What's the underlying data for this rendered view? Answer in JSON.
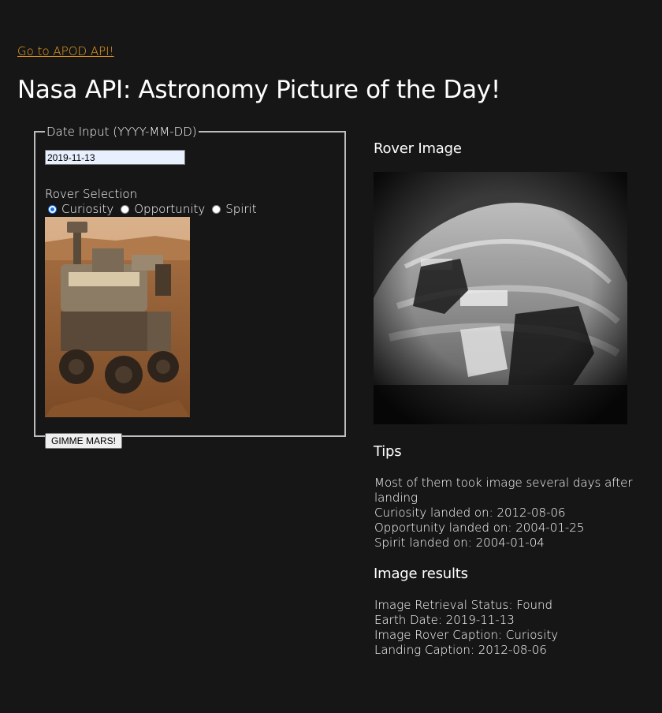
{
  "nav": {
    "apod_link": "Go to APOD API!"
  },
  "page_title": "Nasa API: Astronomy Picture of the Day!",
  "form": {
    "legend": "Date Input (YYYY-MM-DD)",
    "date_value": "2019-11-13",
    "rover_selection_label": "Rover Selection",
    "rovers": [
      {
        "label": "Curiosity",
        "checked": true
      },
      {
        "label": "Opportunity",
        "checked": false
      },
      {
        "label": "Spirit",
        "checked": false
      }
    ],
    "submit_label": "GIMME MARS!"
  },
  "rover_image": {
    "heading": "Rover Image"
  },
  "tips": {
    "heading": "Tips",
    "lines": [
      "Most of them took image several days after landing",
      "Curiosity landed on: 2012-08-06",
      "Opportunity landed on: 2004-01-25",
      "Spirit landed on: 2004-01-04"
    ]
  },
  "results": {
    "heading": "Image results",
    "lines": [
      "Image Retrieval Status: Found",
      "Earth Date: 2019-11-13",
      "Image Rover Caption: Curiosity",
      "Landing Caption: 2012-08-06"
    ]
  },
  "colors": {
    "background": "#161616",
    "link": "#f0a020",
    "text": "#ffffff"
  }
}
